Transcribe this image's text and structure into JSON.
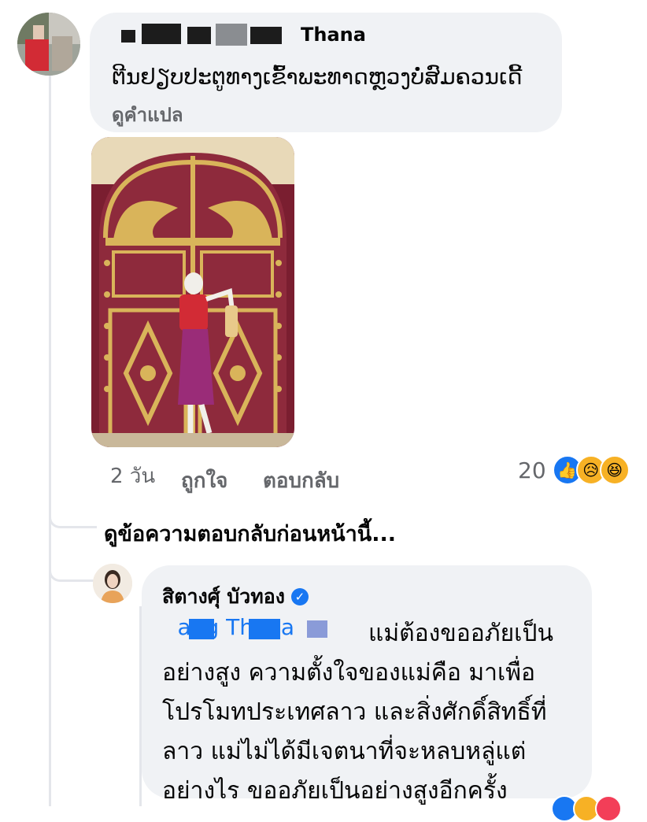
{
  "comment1": {
    "author_visible": "Thana",
    "text": "ຕີນຢຽບປະຕູທາງເຂົ້າພະທາດຫຼວງບໍ່ສົມຄວນເດີ້",
    "translate_label": "ดูคำแปล",
    "time": "2 วัน",
    "like_label": "ถูกใจ",
    "reply_label": "ตอบกลับ",
    "reaction_count": "20",
    "reactions": [
      "like-icon",
      "sad-icon",
      "haha-icon"
    ]
  },
  "view_previous_replies": "ดูข้อความตอบกลับก่อนหน้านี้...",
  "comment2": {
    "author": "สิตางศุ์ บัวทอง",
    "verified": true,
    "tag_visible": "Dang    Thana",
    "line1": "แม่ต้องขออภัยเป็น",
    "line2": "อย่างสูง ความตั้งใจของแม่คือ มาเพื่อ",
    "line3": "โปรโมทประเทศลาว และสิ่งศักดิ์สิทธิ์ที่",
    "line4": "ลาว แม่ไม่ได้มีเจตนาที่จะหลบหลู่แต่",
    "line5": "อย่างไร ขออภัยเป็นอย่างสูงอีกครั้ง"
  },
  "colors": {
    "accent": "#1877f2",
    "bubble": "#f0f2f5",
    "meta": "#65676b",
    "door": "#8e2a3c",
    "gold": "#d9b45a"
  }
}
